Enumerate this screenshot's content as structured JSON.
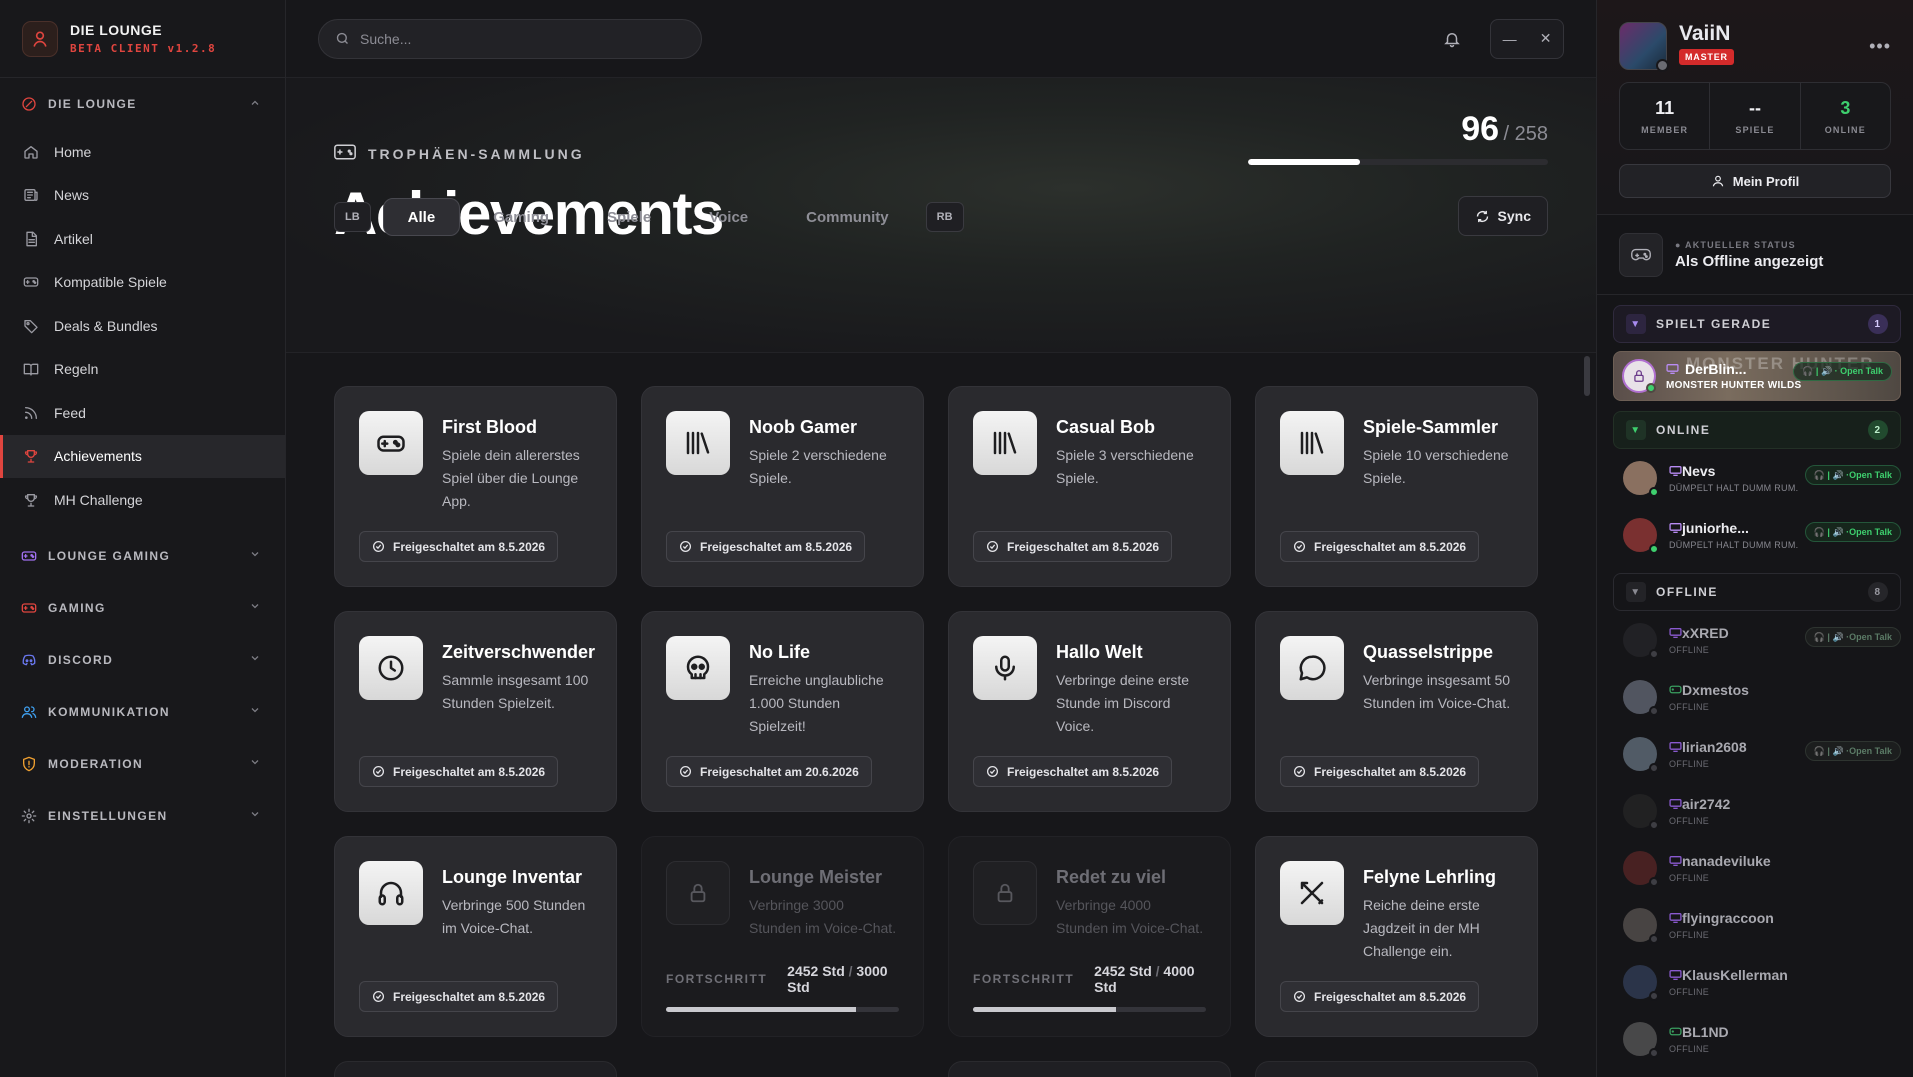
{
  "brand": {
    "title": "DIE LOUNGE",
    "subtitle": "BETA CLIENT v1.2.8"
  },
  "sidebar": {
    "groups": [
      {
        "label": "DIE LOUNGE",
        "icon": "target-icon",
        "color": "#e0453f",
        "expanded": true,
        "items": [
          {
            "label": "Home",
            "icon": "home-icon"
          },
          {
            "label": "News",
            "icon": "newspaper-icon"
          },
          {
            "label": "Artikel",
            "icon": "document-icon"
          },
          {
            "label": "Kompatible Spiele",
            "icon": "gamepad-icon"
          },
          {
            "label": "Deals & Bundles",
            "icon": "tag-icon"
          },
          {
            "label": "Regeln",
            "icon": "book-icon"
          },
          {
            "label": "Feed",
            "icon": "rss-icon"
          },
          {
            "label": "Achievements",
            "icon": "trophy-icon",
            "active": true
          },
          {
            "label": "MH Challenge",
            "icon": "trophy-icon"
          }
        ]
      },
      {
        "label": "LOUNGE GAMING",
        "icon": "gamepad-icon",
        "color": "#a070f0"
      },
      {
        "label": "GAMING",
        "icon": "gamepad-icon",
        "color": "#e0453f"
      },
      {
        "label": "DISCORD",
        "icon": "discord-icon",
        "color": "#6a78f0"
      },
      {
        "label": "KOMMUNIKATION",
        "icon": "users-icon",
        "color": "#3fa0f0"
      },
      {
        "label": "MODERATION",
        "icon": "shield-icon",
        "color": "#f0a030"
      },
      {
        "label": "EINSTELLUNGEN",
        "icon": "gear-icon",
        "color": "#9a9aa2"
      }
    ]
  },
  "search": {
    "placeholder": "Suche..."
  },
  "header": {
    "kicker": "TROPHÄEN-SAMMLUNG",
    "title": "Achievements",
    "unlocked": "96",
    "total": "/ 258",
    "progress": 0.372
  },
  "tabs": {
    "lb": "LB",
    "rb": "RB",
    "items": [
      "Alle",
      "Gaming",
      "Spiele",
      "Voice",
      "Community"
    ],
    "active": 0,
    "sync": "Sync"
  },
  "achievements": [
    {
      "title": "First Blood",
      "desc": "Spiele dein allererstes Spiel über die Lounge App.",
      "icon": "gamepad",
      "unlocked": "Freigeschaltet am 8.5.2026"
    },
    {
      "title": "Noob Gamer",
      "desc": "Spiele 2 verschiedene Spiele.",
      "icon": "library",
      "unlocked": "Freigeschaltet am 8.5.2026"
    },
    {
      "title": "Casual Bob",
      "desc": "Spiele 3 verschiedene Spiele.",
      "icon": "library",
      "unlocked": "Freigeschaltet am 8.5.2026"
    },
    {
      "title": "Spiele-Sammler",
      "desc": "Spiele 10 verschiedene Spiele.",
      "icon": "library",
      "unlocked": "Freigeschaltet am 8.5.2026"
    },
    {
      "title": "Zeitverschwender",
      "desc": "Sammle insgesamt 100 Stunden Spielzeit.",
      "icon": "clock",
      "unlocked": "Freigeschaltet am 8.5.2026"
    },
    {
      "title": "No Life",
      "desc": "Erreiche unglaubliche 1.000 Stunden Spielzeit!",
      "icon": "skull",
      "unlocked": "Freigeschaltet am 20.6.2026"
    },
    {
      "title": "Hallo Welt",
      "desc": "Verbringe deine erste Stunde im Discord Voice.",
      "icon": "mic",
      "unlocked": "Freigeschaltet am 8.5.2026"
    },
    {
      "title": "Quasselstrippe",
      "desc": "Verbringe insgesamt 50 Stunden im Voice-Chat.",
      "icon": "chat",
      "unlocked": "Freigeschaltet am 8.5.2026"
    },
    {
      "title": "Lounge Inventar",
      "desc": "Verbringe 500 Stunden im Voice-Chat.",
      "icon": "headphones",
      "unlocked": "Freigeschaltet am 8.5.2026"
    },
    {
      "title": "Lounge Meister",
      "desc": "Verbringe 3000 Stunden im Voice-Chat.",
      "icon": "lock",
      "locked": true,
      "progress_label": "FORTSCHRITT",
      "current": "2452 Std",
      "target": "3000 Std",
      "fraction": 0.817
    },
    {
      "title": "Redet zu viel",
      "desc": "Verbringe 4000 Stunden im Voice-Chat.",
      "icon": "lock",
      "locked": true,
      "progress_label": "FORTSCHRITT",
      "current": "2452 Std",
      "target": "4000 Std",
      "fraction": 0.613
    },
    {
      "title": "Felyne Lehrling",
      "desc": "Reiche deine erste Jagdzeit in der MH Challenge ein.",
      "icon": "swords",
      "unlocked": "Freigeschaltet am 8.5.2026"
    }
  ],
  "profile": {
    "name": "VaiiN",
    "role": "MASTER",
    "stats": [
      {
        "value": "11",
        "label": "MEMBER"
      },
      {
        "value": "--",
        "label": "SPIELE"
      },
      {
        "value": "3",
        "label": "ONLINE"
      }
    ],
    "button": "Mein Profil"
  },
  "status": {
    "label": "AKTUELLER STATUS",
    "value": "Als Offline angezeigt"
  },
  "sections": {
    "playing": {
      "label": "SPIELT GERADE",
      "count": "1"
    },
    "online": {
      "label": "ONLINE",
      "count": "2"
    },
    "offline": {
      "label": "OFFLINE",
      "count": "8"
    }
  },
  "playing_user": {
    "name": "DerBlin...",
    "game": "MONSTER HUNTER WILDS",
    "bg_text": "MONSTER HUNTER",
    "pill": "Open Talk"
  },
  "online_users": [
    {
      "name": "Nevs",
      "sub": "DÜMPELT HALT DUMM RUM.",
      "pill": "Open Talk"
    },
    {
      "name": "juniorhe...",
      "sub": "DÜMPELT HALT DUMM RUM.",
      "pill": "Open Talk"
    }
  ],
  "offline_users": [
    {
      "name": "xXRED",
      "sub": "OFFLINE",
      "pill": "Open Talk",
      "device": "desktop"
    },
    {
      "name": "Dxmestos",
      "sub": "OFFLINE",
      "device": "gamepad"
    },
    {
      "name": "lirian2608",
      "sub": "OFFLINE",
      "pill": "Open Talk",
      "device": "desktop"
    },
    {
      "name": "air2742",
      "sub": "OFFLINE",
      "device": "desktop"
    },
    {
      "name": "nanadeviluke",
      "sub": "OFFLINE",
      "device": "desktop"
    },
    {
      "name": "flyingraccoon",
      "sub": "OFFLINE",
      "device": "desktop"
    },
    {
      "name": "KlausKellerman",
      "sub": "OFFLINE",
      "device": "desktop"
    },
    {
      "name": "BL1ND",
      "sub": "OFFLINE",
      "device": "gamepad"
    }
  ]
}
